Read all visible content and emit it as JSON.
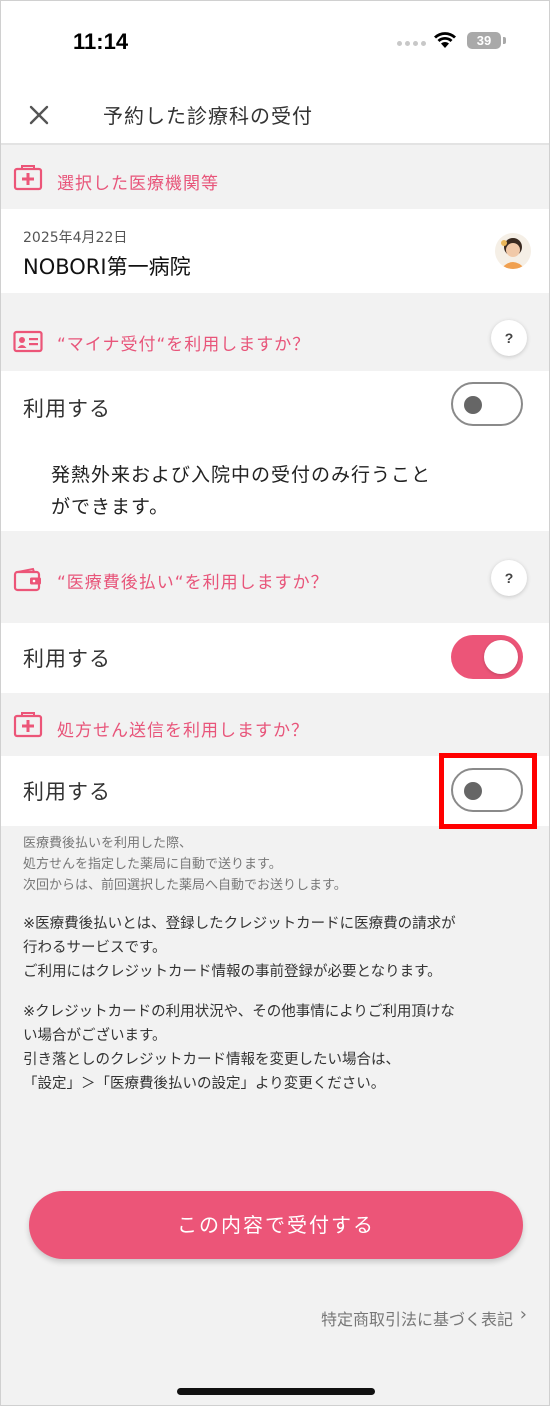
{
  "status_bar": {
    "time": "11:14",
    "battery": "39"
  },
  "header": {
    "title": "予約した診療科の受付"
  },
  "selected_facility": {
    "section_label": "選択した医療機関等",
    "date": "2025年4月22日",
    "name": "NOBORI第一病院"
  },
  "mynumber": {
    "section_label": "“マイナ受付“を利用しますか？",
    "help": "?",
    "use_label": "利用する",
    "toggle_on": false,
    "note_line1": "発熱外来および入院中の受付のみ行うこと",
    "note_line2": "ができます。"
  },
  "deferred_payment": {
    "section_label": "“医療費後払い“を利用しますか？",
    "help": "?",
    "use_label": "利用する",
    "toggle_on": true
  },
  "prescription": {
    "section_label": "処方せん送信を利用しますか？",
    "use_label": "利用する",
    "toggle_on": false
  },
  "notes": {
    "small": [
      "医療費後払いを利用した際、",
      "処方せんを指定した薬局に自動で送ります。",
      "次回からは、前回選択した薬局へ自動でお送りします。"
    ],
    "para1": [
      "※医療費後払いとは、登録したクレジットカードに医療費の請求が",
      "行わるサービスです。",
      "ご利用にはクレジットカード情報の事前登録が必要となります。"
    ],
    "para2": [
      "※クレジットカードの利用状況や、その他事情によりご利用頂けな",
      "い場合がございます。",
      "引き落としのクレジットカード情報を変更したい場合は、",
      "「設定」＞「医療費後払いの設定」より変更ください。"
    ]
  },
  "submit_button": "この内容で受付する",
  "legal_link": "特定商取引法に基づく表記",
  "colors": {
    "accent": "#ec5578",
    "section_text": "#e8557a",
    "highlight": "#ff0000"
  }
}
